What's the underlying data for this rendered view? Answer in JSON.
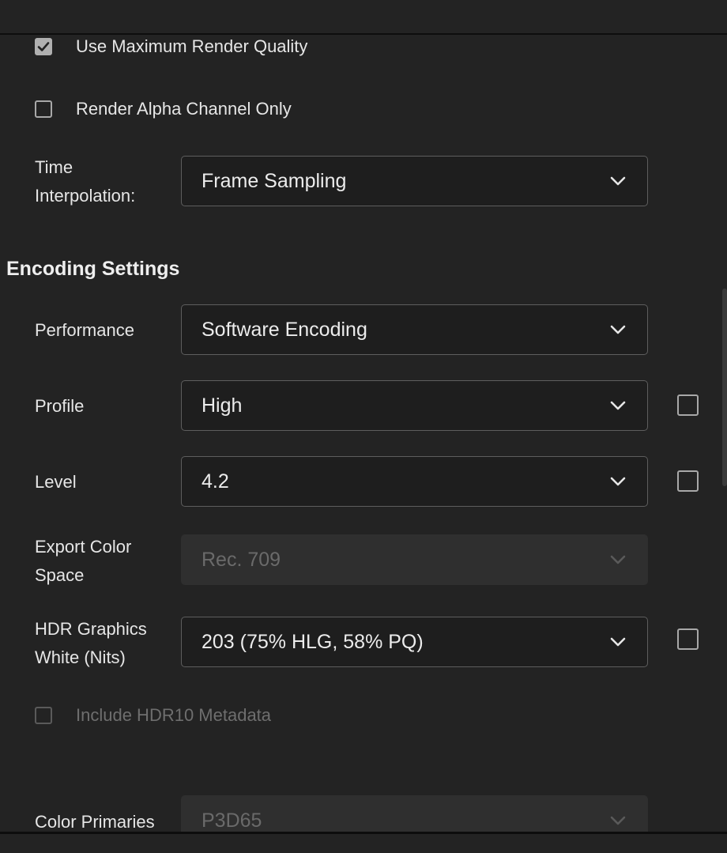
{
  "render_options": {
    "use_max_render_quality": {
      "label": "Use Maximum Render Quality",
      "checked": true
    },
    "render_alpha_only": {
      "label": "Render Alpha Channel Only",
      "checked": false
    },
    "time_interpolation": {
      "label_line1": "Time",
      "label_line2": "Interpolation:",
      "value": "Frame Sampling"
    }
  },
  "encoding": {
    "section_title": "Encoding Settings",
    "performance": {
      "label": "Performance",
      "value": "Software Encoding"
    },
    "profile": {
      "label": "Profile",
      "value": "High"
    },
    "level": {
      "label": "Level",
      "value": "4.2"
    },
    "export_color_space": {
      "label_line1": "Export Color",
      "label_line2": "Space",
      "value": "Rec. 709"
    },
    "hdr_graphics_white": {
      "label_line1": "HDR Graphics",
      "label_line2": "White (Nits)",
      "value": "203 (75% HLG, 58% PQ)"
    },
    "include_hdr10": {
      "label": "Include HDR10 Metadata",
      "checked": false
    },
    "color_primaries": {
      "label": "Color Primaries",
      "value": "P3D65"
    }
  },
  "icons": {
    "dropdown_arrow": "chevron-down-icon",
    "check": "checkmark-icon"
  }
}
